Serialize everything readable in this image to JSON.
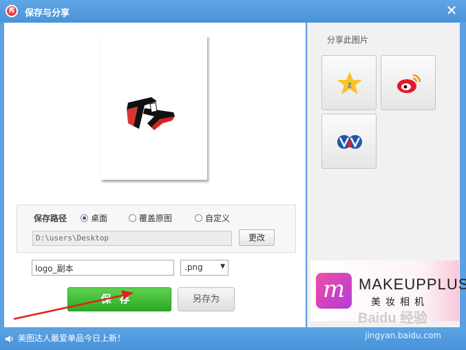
{
  "window": {
    "title": "保存与分享",
    "app_logo_text": "秀",
    "close_label": "✕"
  },
  "save_path": {
    "label": "保存路径",
    "options": [
      "桌面",
      "覆盖原图",
      "自定义"
    ],
    "selected": "桌面",
    "path_value": "D:\\users\\Desktop",
    "change_button": "更改"
  },
  "file": {
    "name": "logo_副本",
    "format": ".png"
  },
  "actions": {
    "save": "保存",
    "save_as": "另存为"
  },
  "share": {
    "title": "分享此图片",
    "buttons": [
      "qzone-icon",
      "weibo-icon",
      "renren-icon"
    ]
  },
  "ad": {
    "name": "MAKEUPPLUS",
    "subtitle": "美妆相机"
  },
  "status": {
    "message": "美图达人最爱单品今日上新！",
    "watermark_logo": "Baidu 经验",
    "watermark_url": "jingyan.baidu.com"
  },
  "colors": {
    "titlebar": "#4a93d8",
    "save_button": "#2daa22",
    "annotation_arrow": "#e02020"
  }
}
